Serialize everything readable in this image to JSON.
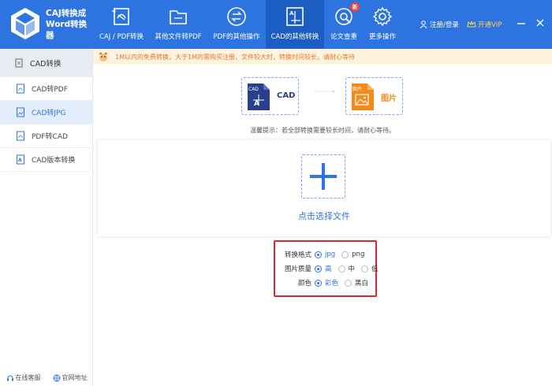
{
  "app": {
    "title_line1": "CAJ转换成",
    "title_line2": "Word转换",
    "title_line3": "器"
  },
  "nav": [
    {
      "label": "CAJ / PDF转换",
      "icon": "caj-pdf-icon"
    },
    {
      "label": "其他文件转PDF",
      "icon": "folder-icon"
    },
    {
      "label": "PDF的其他操作",
      "icon": "convert-arrows-icon"
    },
    {
      "label": "CAD的其他转换",
      "icon": "cad-icon"
    },
    {
      "label": "论文查重",
      "icon": "paper-check-icon",
      "badge": "新"
    },
    {
      "label": "更多操作",
      "icon": "gear-icon"
    }
  ],
  "header": {
    "login": "注册/登录",
    "vip": "开通VIP"
  },
  "sidebar": {
    "head": "CAD转换",
    "items": [
      {
        "label": "CAD转PDF"
      },
      {
        "label": "CAD转JPG"
      },
      {
        "label": "PDF转CAD"
      },
      {
        "label": "CAD版本转换"
      }
    ],
    "footer_service": "在线客服",
    "footer_site": "官网地址"
  },
  "notice": {
    "text": "1M以内的免费转换，大于1M的需购买注册，文件较大时，转换时间较长，请耐心等待"
  },
  "conversion": {
    "from_tag": "CAD",
    "from_label": "CAD",
    "to_tag": "图片",
    "to_label": "图片"
  },
  "tip": "温馨提示：若全部转换需要较长时间，请耐心等待。",
  "upload": {
    "label": "点击选择文件"
  },
  "options": {
    "format_label": "转换格式",
    "format_jpg": "jpg",
    "format_png": "png",
    "quality_label": "图片质量",
    "quality_high": "高",
    "quality_mid": "中",
    "quality_low": "低",
    "color_label": "颜色",
    "color_color": "彩色",
    "color_bw": "黑白",
    "selected": {
      "format": "jpg",
      "quality": "高",
      "color": "彩色"
    }
  },
  "colors": {
    "accent": "#2d74e0",
    "highlight_border": "#e0262b",
    "notice_text": "#e0782f",
    "image_orange": "#f28a1c"
  }
}
